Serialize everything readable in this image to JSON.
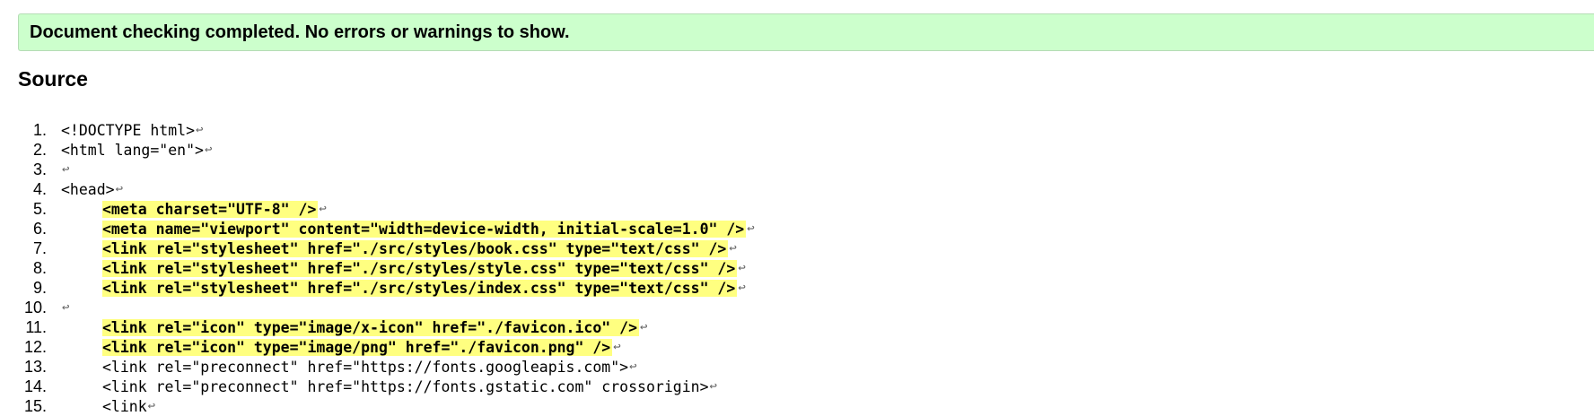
{
  "status": {
    "message": "Document checking completed. No errors or warnings to show."
  },
  "source": {
    "heading": "Source",
    "return_glyph": "↩",
    "lines": [
      {
        "number": "1.",
        "indent": false,
        "highlight": false,
        "text": "<!DOCTYPE html>"
      },
      {
        "number": "2.",
        "indent": false,
        "highlight": false,
        "text": "<html lang=\"en\">"
      },
      {
        "number": "3.",
        "indent": false,
        "highlight": false,
        "text": ""
      },
      {
        "number": "4.",
        "indent": false,
        "highlight": false,
        "text": "<head>"
      },
      {
        "number": "5.",
        "indent": true,
        "highlight": true,
        "text": "<meta charset=\"UTF-8\" />"
      },
      {
        "number": "6.",
        "indent": true,
        "highlight": true,
        "text": "<meta name=\"viewport\" content=\"width=device-width, initial-scale=1.0\" />"
      },
      {
        "number": "7.",
        "indent": true,
        "highlight": true,
        "text": "<link rel=\"stylesheet\" href=\"./src/styles/book.css\" type=\"text/css\" />"
      },
      {
        "number": "8.",
        "indent": true,
        "highlight": true,
        "text": "<link rel=\"stylesheet\" href=\"./src/styles/style.css\" type=\"text/css\" />"
      },
      {
        "number": "9.",
        "indent": true,
        "highlight": true,
        "text": "<link rel=\"stylesheet\" href=\"./src/styles/index.css\" type=\"text/css\" />"
      },
      {
        "number": "10.",
        "indent": false,
        "highlight": false,
        "text": ""
      },
      {
        "number": "11.",
        "indent": true,
        "highlight": true,
        "text": "<link rel=\"icon\" type=\"image/x-icon\" href=\"./favicon.ico\" />"
      },
      {
        "number": "12.",
        "indent": true,
        "highlight": true,
        "text": "<link rel=\"icon\" type=\"image/png\" href=\"./favicon.png\" />"
      },
      {
        "number": "13.",
        "indent": true,
        "highlight": false,
        "text": "<link rel=\"preconnect\" href=\"https://fonts.googleapis.com\">"
      },
      {
        "number": "14.",
        "indent": true,
        "highlight": false,
        "text": "<link rel=\"preconnect\" href=\"https://fonts.gstatic.com\" crossorigin>"
      },
      {
        "number": "15.",
        "indent": true,
        "highlight": false,
        "text": "<link"
      }
    ]
  },
  "colors": {
    "success_background": "#ccffcc",
    "highlight_background": "#ffff80"
  }
}
